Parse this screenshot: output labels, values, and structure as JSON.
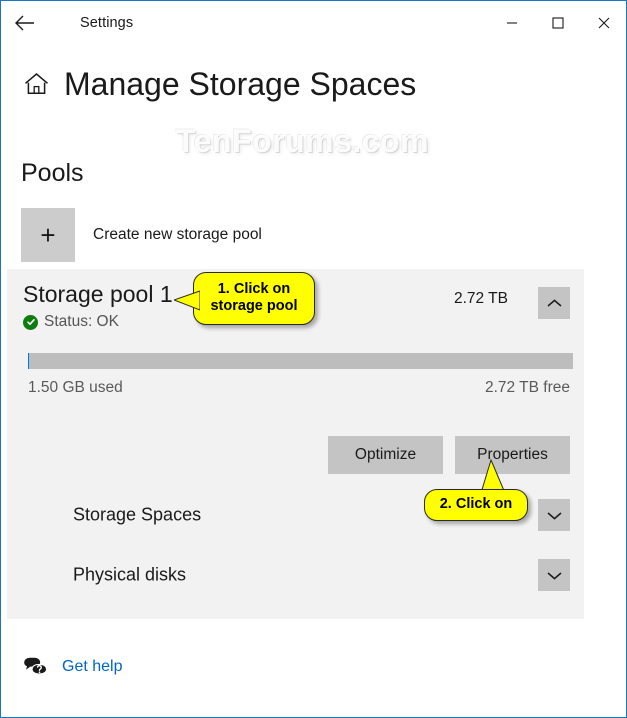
{
  "window": {
    "title": "Settings",
    "back_icon": "back-arrow-icon",
    "minimize_label": "—",
    "maximize_label": "□",
    "close_label": "✕"
  },
  "header": {
    "home_icon": "home-icon",
    "page_title": "Manage Storage Spaces"
  },
  "watermark": {
    "text": "TenForums.com"
  },
  "pools_section": {
    "title": "Pools",
    "create_pool": {
      "icon": "plus-icon",
      "plus_glyph": "+",
      "label": "Create new storage pool"
    }
  },
  "pool": {
    "name": "Storage pool 1",
    "status_icon": "check-circle-icon",
    "status_text": "Status: OK",
    "capacity": "2.72 TB",
    "collapse_icon": "chevron-up-icon",
    "used_label": "1.50 GB used",
    "free_label": "2.72 TB free",
    "used_percent": 0.05,
    "buttons": {
      "optimize": "Optimize",
      "properties": "Properties"
    },
    "expanders": [
      {
        "label": "Storage Spaces",
        "icon": "chevron-down-icon"
      },
      {
        "label": "Physical disks",
        "icon": "chevron-down-icon"
      }
    ]
  },
  "footer": {
    "help_icon": "help-question-bubble-icon",
    "help_label": "Get help"
  },
  "callouts": [
    {
      "text": "1. Click on storage pool",
      "line1": "1. Click on",
      "line2": "storage pool"
    },
    {
      "text": "2. Click on",
      "line1": "2. Click on",
      "line2": ""
    }
  ],
  "colors": {
    "window_border": "#1b76c2",
    "accent_link": "#0067c0",
    "status_ok": "#107c10",
    "card_bg": "#f2f2f2",
    "button_bg": "#c4c4c4",
    "callout_bg": "#ffff00"
  }
}
